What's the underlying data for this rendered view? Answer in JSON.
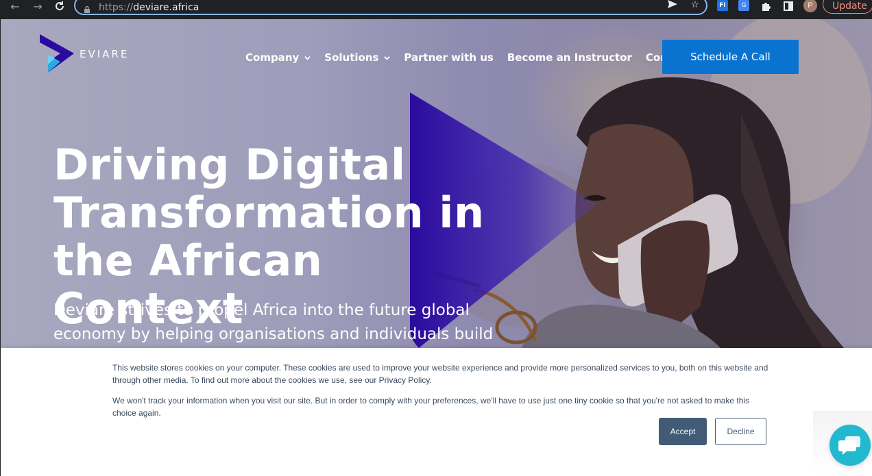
{
  "browser": {
    "url_protocol": "https://",
    "url_host": "deviare.africa",
    "update_label": "Update",
    "profile_initial": "P",
    "extension_fi_label": "FI",
    "extension_translate_label": "G"
  },
  "site": {
    "logo_text": "EVIARE",
    "nav": [
      {
        "label": "Company",
        "has_dropdown": true
      },
      {
        "label": "Solutions",
        "has_dropdown": true
      },
      {
        "label": "Partner with us",
        "has_dropdown": false
      },
      {
        "label": "Become an Instructor",
        "has_dropdown": false
      },
      {
        "label": "Contact",
        "has_dropdown": false
      }
    ],
    "cta_label": "Schedule A Call",
    "headline": "Driving Digital Transformation in the African Context",
    "subline": "Deviare strives to propel Africa into the future global economy by helping organisations and individuals build capability and",
    "accent_color": "#0a73d0",
    "brand_purple": "#2b0a9e"
  },
  "cookie_banner": {
    "text_1": "This website stores cookies on your computer. These cookies are used to improve your website experience and provide more personalized services to you, both on this website and through other media. To find out more about the cookies we use, see our Privacy Policy.",
    "text_2": "We won't track your information when you visit our site. But in order to comply with your preferences, we'll have to use just one tiny cookie so that you're not asked to make this choice again.",
    "accept_label": "Accept",
    "decline_label": "Decline"
  }
}
